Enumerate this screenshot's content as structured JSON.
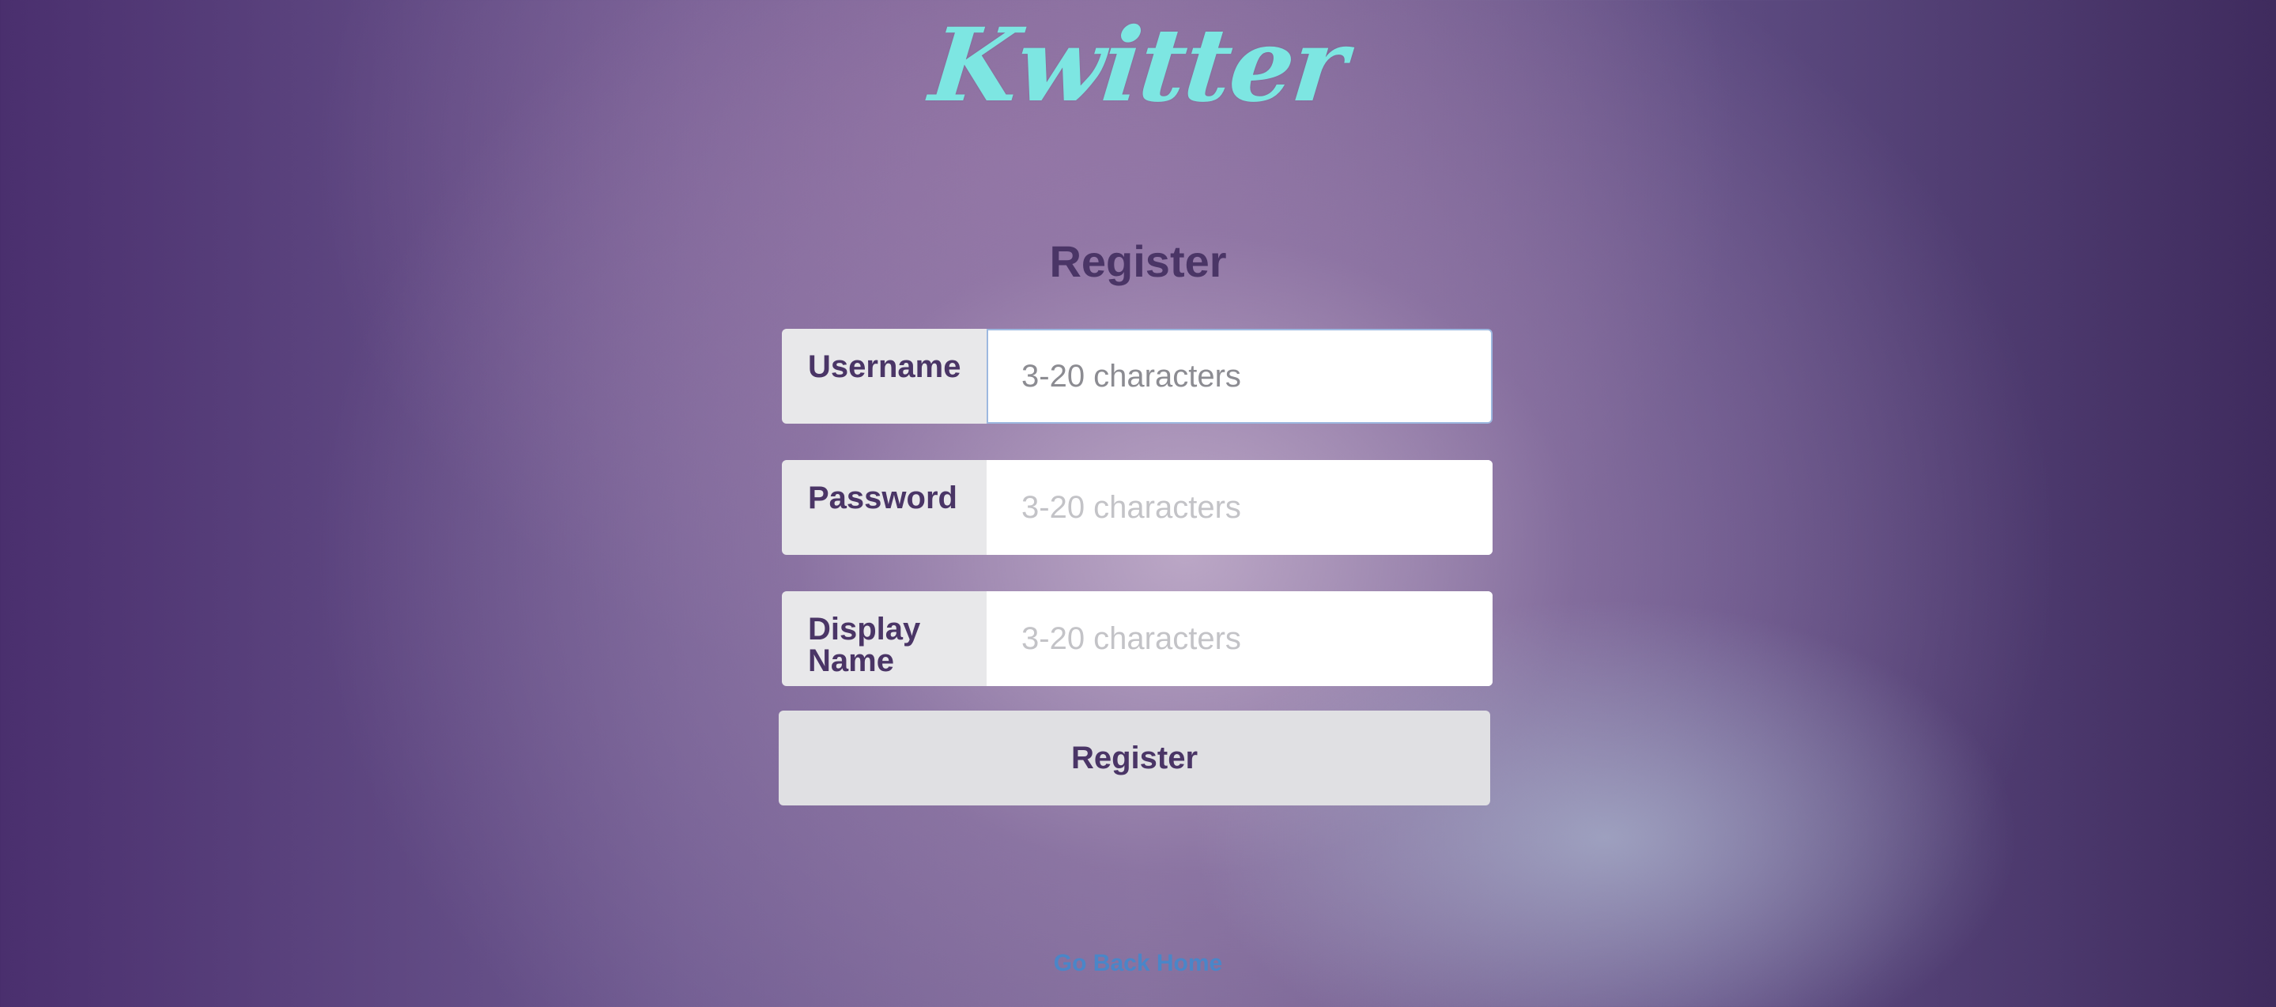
{
  "app": {
    "logo_text": "Kwitter",
    "logo_color": "#7de6e2"
  },
  "form": {
    "title": "Register",
    "fields": [
      {
        "label": "Username",
        "placeholder": "3-20 characters",
        "value": ""
      },
      {
        "label": "Password",
        "placeholder": "3-20 characters",
        "value": ""
      },
      {
        "label": "Display Name",
        "placeholder": "3-20 characters",
        "value": ""
      }
    ],
    "submit_label": "Register"
  },
  "footer": {
    "home_link": "Go Back Home",
    "link_color": "#4a86c8"
  }
}
